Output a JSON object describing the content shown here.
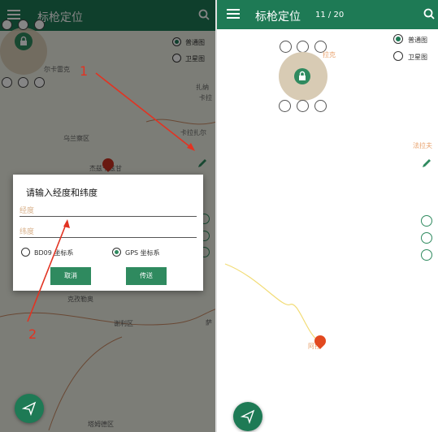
{
  "colors": {
    "primary": "#1e7a55",
    "accent": "#2f8a5f",
    "annotation": "#e23322",
    "marker": "#c9301f"
  },
  "left": {
    "app_title": "标枪定位",
    "map_type": {
      "normal": "普通图",
      "satellite": "卫星图"
    },
    "map_labels": [
      "尔卡雷克",
      "扎纳",
      "卡拉",
      "卡拉扎尔",
      "乌兰察区",
      "杰兹卡兹甘",
      "克孜勒奥",
      "谢利区",
      "塔姆德区",
      "萨"
    ],
    "dialog": {
      "title": "请输入经度和纬度",
      "longitude_placeholder": "经度",
      "latitude_placeholder": "纬度",
      "option_bd09": "BD09 坐标系",
      "option_gps": "GPS 坐标系",
      "cancel": "取消",
      "send": "传送"
    },
    "annotations": {
      "one": "1",
      "two": "2"
    }
  },
  "right": {
    "app_title": "标枪定位",
    "counter": "11 / 20",
    "map_type": {
      "normal": "普通图",
      "satellite": "卫星图"
    },
    "map_labels": {
      "top": "拉克",
      "right": "法拉夫",
      "bottom": "阿拉"
    }
  },
  "icons": [
    "menu-icon",
    "search-icon",
    "move-icon",
    "gps-icon",
    "fog-icon",
    "lock-icon",
    "walk-icon",
    "run-icon",
    "bike-icon",
    "edit-icon",
    "locate-icon",
    "zoom-in-icon",
    "zoom-out-icon",
    "send-icon"
  ]
}
